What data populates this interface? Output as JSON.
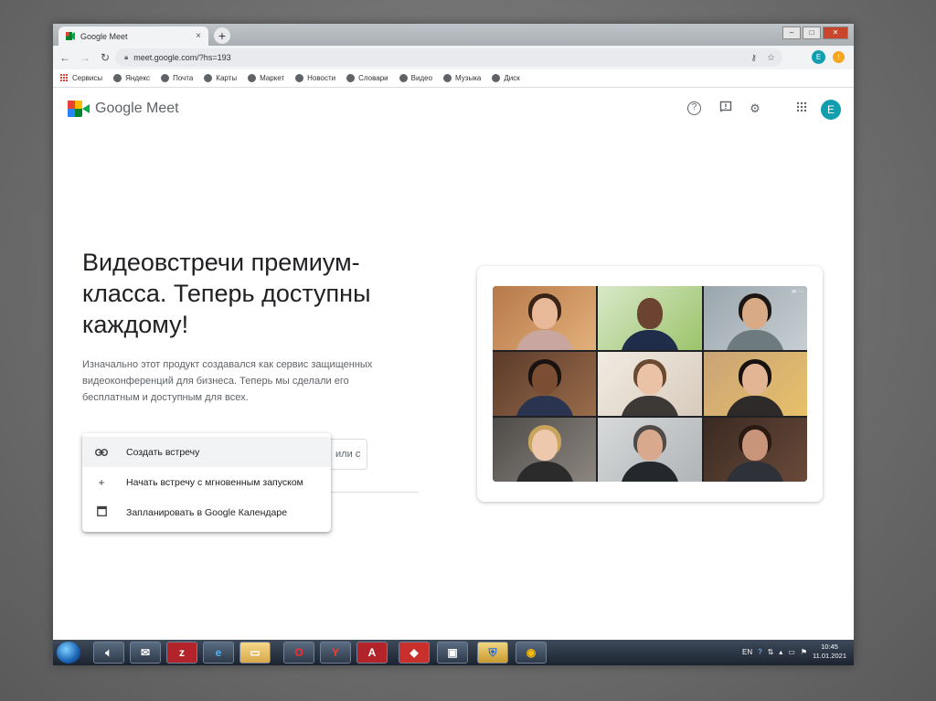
{
  "browser": {
    "tab_title": "Google Meet",
    "tab_close": "×",
    "new_tab": "+",
    "url": "meet.google.com/?hs=193",
    "profile_initial": "E",
    "bookmarks": [
      "Сервисы",
      "Яндекс",
      "Почта",
      "Карты",
      "Маркет",
      "Новости",
      "Словари",
      "Видео",
      "Музыка",
      "Диск"
    ]
  },
  "header": {
    "logo_text": "Google Meet",
    "avatar_initial": "E",
    "icons": [
      "help-icon",
      "feedback-icon",
      "settings-icon",
      "apps-grid-icon"
    ]
  },
  "hero": {
    "headline": "Видеовстречи премиум-класса. Теперь доступны каждому!",
    "subtext": "Изначально этот продукт создавался как сервис защищенных видеоконференций для бизнеса. Теперь мы сделали его бесплатным и доступным для всех.",
    "join_placeholder": "или с"
  },
  "menu": {
    "items": [
      {
        "label": "Создать встречу",
        "icon": "link-icon"
      },
      {
        "label": "Начать встречу с мгновенным запуском",
        "icon": "plus-icon"
      },
      {
        "label": "Запланировать в Google Календаре",
        "icon": "calendar-icon"
      }
    ]
  },
  "taskbar": {
    "apps": [
      "speaker",
      "mail",
      "zynga",
      "internet-explorer",
      "file-explorer",
      "opera",
      "yandex",
      "acrobat",
      "red-app",
      "window-app",
      "shield-app",
      "chrome"
    ],
    "lang": "EN",
    "time": "10:45",
    "date": "11.01.2021"
  },
  "colors": {
    "accent_teal": "#129eaf",
    "meet_green": "#00832d",
    "text_primary": "#202124",
    "text_secondary": "#5f6368"
  }
}
